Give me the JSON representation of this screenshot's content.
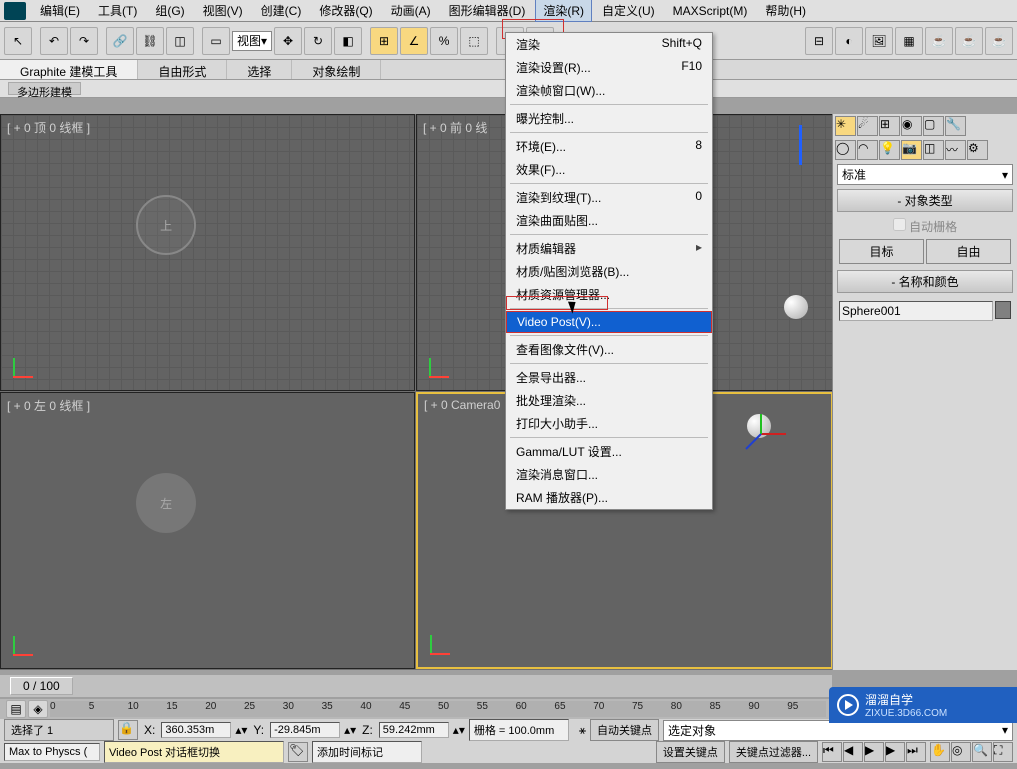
{
  "menubar": {
    "items": [
      "编辑(E)",
      "工具(T)",
      "组(G)",
      "视图(V)",
      "创建(C)",
      "修改器(Q)",
      "动画(A)",
      "图形编辑器(D)",
      "渲染(R)",
      "自定义(U)",
      "MAXScript(M)",
      "帮助(H)"
    ]
  },
  "toolbar": {
    "view_dd": "视图"
  },
  "ribbon": {
    "tabs": [
      "Graphite 建模工具",
      "自由形式",
      "选择",
      "对象绘制"
    ],
    "sub": "多边形建模"
  },
  "viewports": {
    "labels": [
      "[ + 0 顶 0 线框 ]",
      "[ + 0 前 0 线",
      "[ + 0 左 0 线框 ]",
      "[ + 0 Camera0"
    ],
    "gizmo_left": "左"
  },
  "render_menu": [
    {
      "label": "渲染",
      "shortcut": "Shift+Q"
    },
    {
      "label": "渲染设置(R)...",
      "shortcut": "F10"
    },
    {
      "label": "渲染帧窗口(W)..."
    },
    {
      "sep": true
    },
    {
      "label": "曝光控制..."
    },
    {
      "sep": true
    },
    {
      "label": "环境(E)...",
      "shortcut": "8"
    },
    {
      "label": "效果(F)..."
    },
    {
      "sep": true
    },
    {
      "label": "渲染到纹理(T)...",
      "shortcut": "0"
    },
    {
      "label": "渲染曲面贴图..."
    },
    {
      "sep": true
    },
    {
      "label": "材质编辑器",
      "sub": true
    },
    {
      "label": "材质/贴图浏览器(B)..."
    },
    {
      "label": "材质资源管理器..."
    },
    {
      "sep": true
    },
    {
      "label": "Video Post(V)...",
      "hl": true
    },
    {
      "sep": true
    },
    {
      "label": "查看图像文件(V)..."
    },
    {
      "sep": true
    },
    {
      "label": "全景导出器..."
    },
    {
      "label": "批处理渲染..."
    },
    {
      "label": "打印大小助手..."
    },
    {
      "sep": true
    },
    {
      "label": "Gamma/LUT 设置..."
    },
    {
      "label": "渲染消息窗口..."
    },
    {
      "label": "RAM 播放器(P)..."
    }
  ],
  "panel": {
    "dropdown": "标准",
    "rollout1_title": "对象类型",
    "autogrid": "自动栅格",
    "btn_target": "目标",
    "btn_free": "自由",
    "rollout2_title": "名称和颜色",
    "obj_name": "Sphere001"
  },
  "timeline": {
    "slider": "0 / 100",
    "ticks": [
      "0",
      "5",
      "10",
      "15",
      "20",
      "25",
      "30",
      "35",
      "40",
      "45",
      "50",
      "55",
      "60",
      "65",
      "70",
      "75",
      "80",
      "85",
      "90",
      "95"
    ]
  },
  "status": {
    "sel_label": "选择了 1",
    "x_label": "X:",
    "x_val": "360.353m",
    "y_label": "Y:",
    "y_val": "-29.845m",
    "z_label": "Z:",
    "z_val": "59.242mm",
    "grid_label": "栅格 = 100.0mm",
    "autokey": "自动关键点",
    "selset": "选定对象",
    "add_tag": "添加时间标记",
    "setkey": "设置关键点",
    "keyfilter": "关键点过滤器...",
    "script_label": "Max to Physcs (",
    "tooltip": "Video Post 对话框切换"
  },
  "watermark": {
    "brand": "溜溜自学",
    "url": "ZIXUE.3D66.COM"
  }
}
